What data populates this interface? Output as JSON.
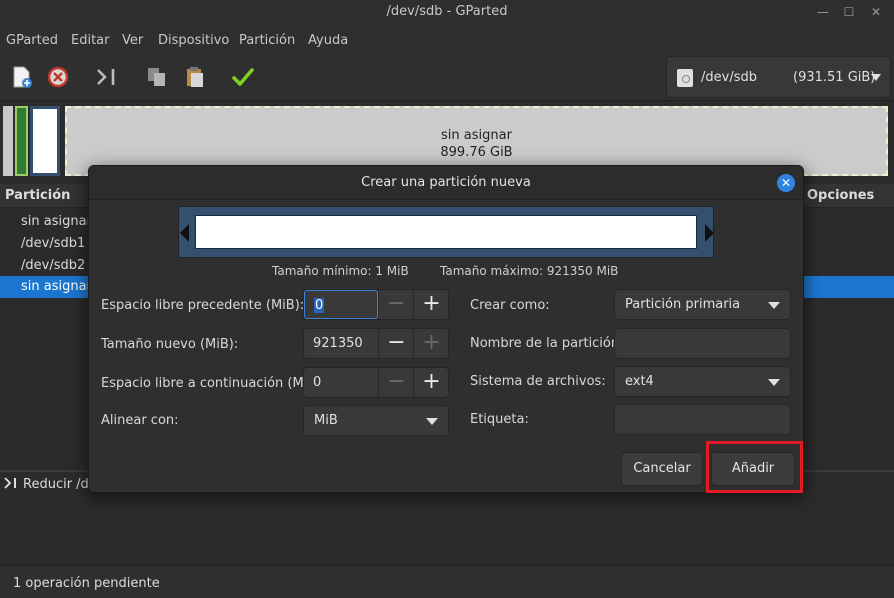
{
  "window": {
    "title": "/dev/sdb - GParted"
  },
  "menu": [
    "GParted",
    "Editar",
    "Ver",
    "Dispositivo",
    "Partición",
    "Ayuda"
  ],
  "device_selector": {
    "name": "/dev/sdb",
    "size": "(931.51 GiB)"
  },
  "disk_map": {
    "label": "sin asignar",
    "size": "899.76 GiB"
  },
  "partition_list": {
    "headers": {
      "partition": "Partición",
      "options": "Opciones"
    },
    "rows": [
      {
        "name": "sin asignar",
        "selected": false
      },
      {
        "name": "/dev/sdb1",
        "selected": false
      },
      {
        "name": "/dev/sdb2",
        "selected": false
      },
      {
        "name": "sin asignar",
        "selected": true
      }
    ]
  },
  "operations": {
    "item": "Reducir /dev"
  },
  "status": {
    "text": "1 operación pendiente"
  },
  "dialog": {
    "title": "Crear una partición nueva",
    "min_size": "Tamaño mínimo: 1 MiB",
    "max_size": "Tamaño máximo: 921350 MiB",
    "fields": {
      "free_before": {
        "label": "Espacio libre precedente (MiB):",
        "value": "0"
      },
      "new_size": {
        "label": "Tamaño nuevo (MiB):",
        "value": "921350"
      },
      "free_after": {
        "label": "Espacio libre a continuación (MiB):",
        "value": "0"
      },
      "align": {
        "label": "Alinear con:",
        "value": "MiB"
      },
      "create_as": {
        "label": "Crear como:",
        "value": "Partición primaria"
      },
      "partition_name": {
        "label": "Nombre de la partición:",
        "value": ""
      },
      "filesystem": {
        "label": "Sistema de archivos:",
        "value": "ext4"
      },
      "fs_label": {
        "label": "Etiqueta:",
        "value": ""
      }
    },
    "buttons": {
      "cancel": "Cancelar",
      "add": "Añadir"
    }
  },
  "colors": {
    "accent": "#1c76d0",
    "highlight_box": "#e01b24",
    "apply_check": "#7ed321"
  }
}
